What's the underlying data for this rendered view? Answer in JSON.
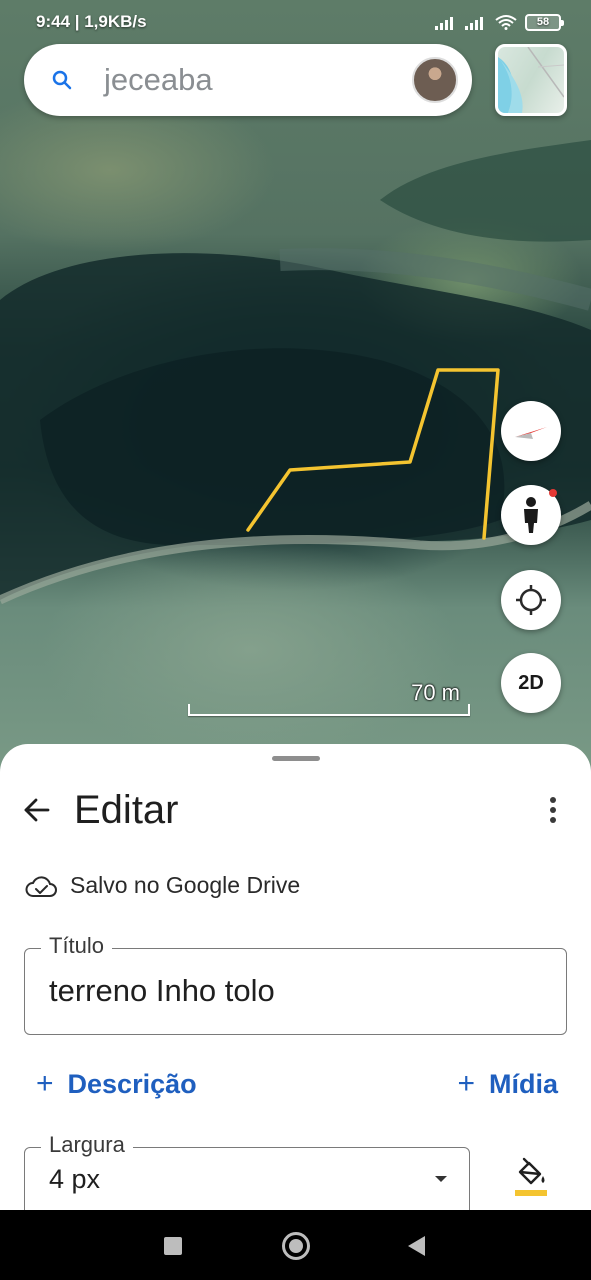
{
  "status_bar": {
    "time_speed": "9:44 | 1,9KB/s",
    "battery": "58"
  },
  "search": {
    "query": "jeceaba",
    "search_icon": "search-icon"
  },
  "map": {
    "scale_label": "70 m",
    "btn_2d_label": "2D",
    "polyline_color": "#f4c430",
    "icons": [
      "compass-icon",
      "street-view-icon",
      "my-location-icon"
    ]
  },
  "sheet": {
    "title": "Editar",
    "saved_status": "Salvo no Google Drive",
    "title_field": {
      "label": "Título",
      "value": "terreno Inho tolo"
    },
    "add_description": "Descrição",
    "add_media": "Mídia",
    "plus": "+",
    "width_field": {
      "label": "Largura",
      "value": "4 px"
    },
    "accent_color": "#1f5fbf",
    "stroke_color": "#f4c430"
  }
}
